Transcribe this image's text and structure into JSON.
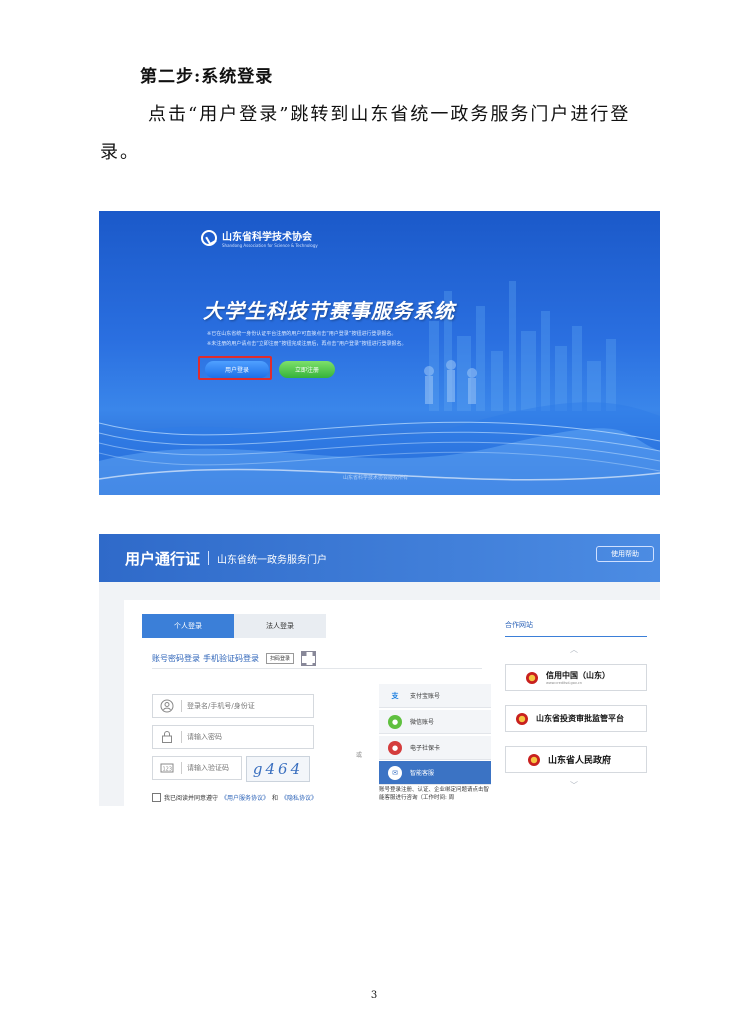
{
  "heading": "第二步:系统登录",
  "paragraph": {
    "line1": "点击“用户登录”跳转到山东省统一政务服务门户进行登",
    "line2": "录。"
  },
  "screenshot1": {
    "logo_cn": "山东省科学技术协会",
    "logo_en": "Shandong Association for Science & Technology",
    "system_title": "大学生科技节赛事服务系统",
    "note1": "※已在山东省统一身份认证平台注册的用户可直接点击“用户登录”按钮进行登录报名。",
    "note2": "※未注册的用户请点击“立即注册”按钮完成注册后，再点击“用户登录”按钮进行登录报名。",
    "login_button": "用户登录",
    "register_button": "立即注册",
    "footer": "山东省科学技术协会版权所有"
  },
  "screenshot2": {
    "brand": "用户通行证",
    "portal": "山东省统一政务服务门户",
    "help": "使用帮助",
    "tabs": [
      "个人登录",
      "法人登录"
    ],
    "methods": {
      "password": "账号密码登录",
      "sms": "手机验证码登录",
      "scan": "扫码登录"
    },
    "fields": {
      "username": "登录名/手机号/身份证",
      "password": "请输入密码",
      "captcha": "请输入验证码",
      "captcha_code": "g464"
    },
    "agree": {
      "prefix": "我已阅读并同意遵守",
      "link1": "《用户服务协议》",
      "and": "和",
      "link2": "《隐私协议》"
    },
    "or": "或",
    "alt_logins": [
      "支付宝账号",
      "微信账号",
      "电子社保卡",
      "智能客服"
    ],
    "alt_note": "账号登录注册、认证、企业绑定问题请点击智能客服进行咨询（工作时间: 周",
    "partners_title": "合作网站",
    "partners": [
      {
        "name": "信用中国（山东）",
        "sub": "www.creditsd.gov.cn"
      },
      {
        "name": "山东省投资审批监管平台"
      },
      {
        "name": "山东省人民政府"
      }
    ],
    "arrow_up": "︿",
    "arrow_down": "﹀"
  },
  "page_number": "3"
}
